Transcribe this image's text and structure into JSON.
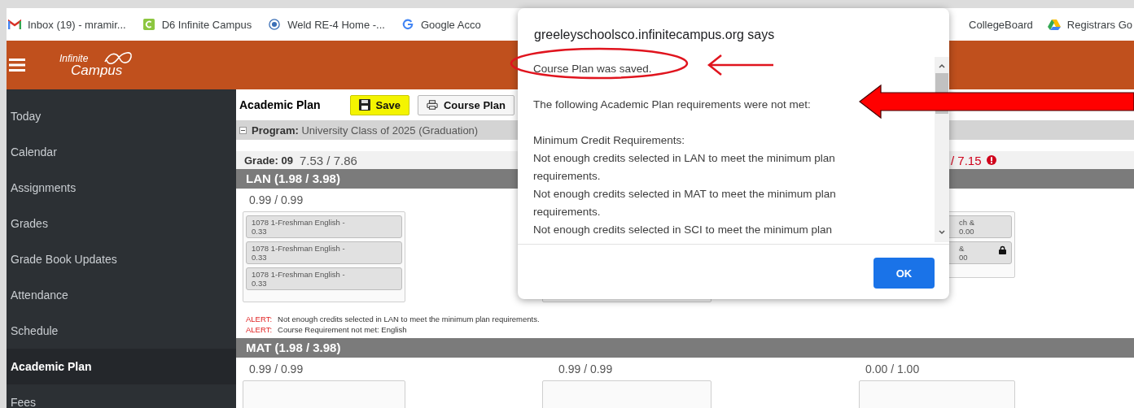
{
  "bookmarks": [
    {
      "label": "Inbox (19) - mramir...",
      "kind": "mail"
    },
    {
      "label": "D6 Infinite Campus",
      "kind": "square"
    },
    {
      "label": "Weld RE-4 Home -...",
      "kind": "seal"
    },
    {
      "label": "Google Acco",
      "kind": "google"
    }
  ],
  "bookmarks_right": [
    {
      "label": "CollegeBoard",
      "kind": "none"
    },
    {
      "label": "Registrars Go",
      "kind": "drive"
    }
  ],
  "header": {
    "logo_top": "Infinite",
    "logo_bottom": "Campus"
  },
  "sidebar": {
    "items": [
      {
        "label": "Today",
        "selected": false
      },
      {
        "label": "Calendar",
        "selected": false
      },
      {
        "label": "Assignments",
        "selected": false
      },
      {
        "label": "Grades",
        "selected": false
      },
      {
        "label": "Grade Book Updates",
        "selected": false
      },
      {
        "label": "Attendance",
        "selected": false
      },
      {
        "label": "Schedule",
        "selected": false
      },
      {
        "label": "Academic Plan",
        "selected": true
      },
      {
        "label": "Fees",
        "selected": false
      }
    ]
  },
  "toolbar": {
    "title": "Academic Plan",
    "buttons": [
      {
        "label": "Save",
        "kind": "save",
        "highlighted": true
      },
      {
        "label": "Course Plan",
        "kind": "print",
        "highlighted": false
      }
    ]
  },
  "program": {
    "label": "Program:",
    "value": "University Class of 2025 (Graduation)",
    "expanded": true
  },
  "grade_row": {
    "first": {
      "label": "Grade: 09",
      "credits": "7.53 / 7.86",
      "warning": false
    },
    "third": {
      "credits": "/ 7.15",
      "warning": true
    }
  },
  "sections": [
    {
      "title": "LAN (1.98 / 3.98)",
      "columns": [
        {
          "credits": "0.99 / 0.99",
          "courses": [
            {
              "name": "1078 1-Freshman English -\n0.33",
              "locked": false
            },
            {
              "name": "1078 1-Freshman English -\n0.33",
              "locked": false
            },
            {
              "name": "1078 1-Freshman English -\n0.33",
              "locked": false
            }
          ]
        },
        {},
        {
          "courses": [
            {
              "name": "ch &\n0.00",
              "locked": false
            },
            {
              "name": "&\n00",
              "locked": true
            }
          ]
        }
      ],
      "alerts": [
        {
          "label": "ALERT:",
          "text": "Not enough credits selected in LAN to meet the minimum plan requirements."
        },
        {
          "label": "ALERT:",
          "text": "Course Requirement not met: English"
        }
      ]
    },
    {
      "title": "MAT (1.98 / 3.98)",
      "columns": [
        {
          "credits": "0.99 / 0.99"
        },
        {
          "credits": "0.99 / 0.99"
        },
        {
          "credits": "0.00 / 1.00"
        }
      ]
    }
  ],
  "dialog": {
    "title": "greeleyschoolsco.infinitecampus.org says",
    "saved": "Course Plan was saved.",
    "intro": "The following Academic Plan requirements were not met:",
    "heading": "Minimum Credit Requirements:",
    "items": [
      "Not enough credits selected in LAN to meet the minimum plan requirements.",
      "Not enough credits selected in MAT to meet the minimum plan requirements.",
      "Not enough credits selected in SCI to meet the minimum plan"
    ],
    "button": "OK"
  }
}
